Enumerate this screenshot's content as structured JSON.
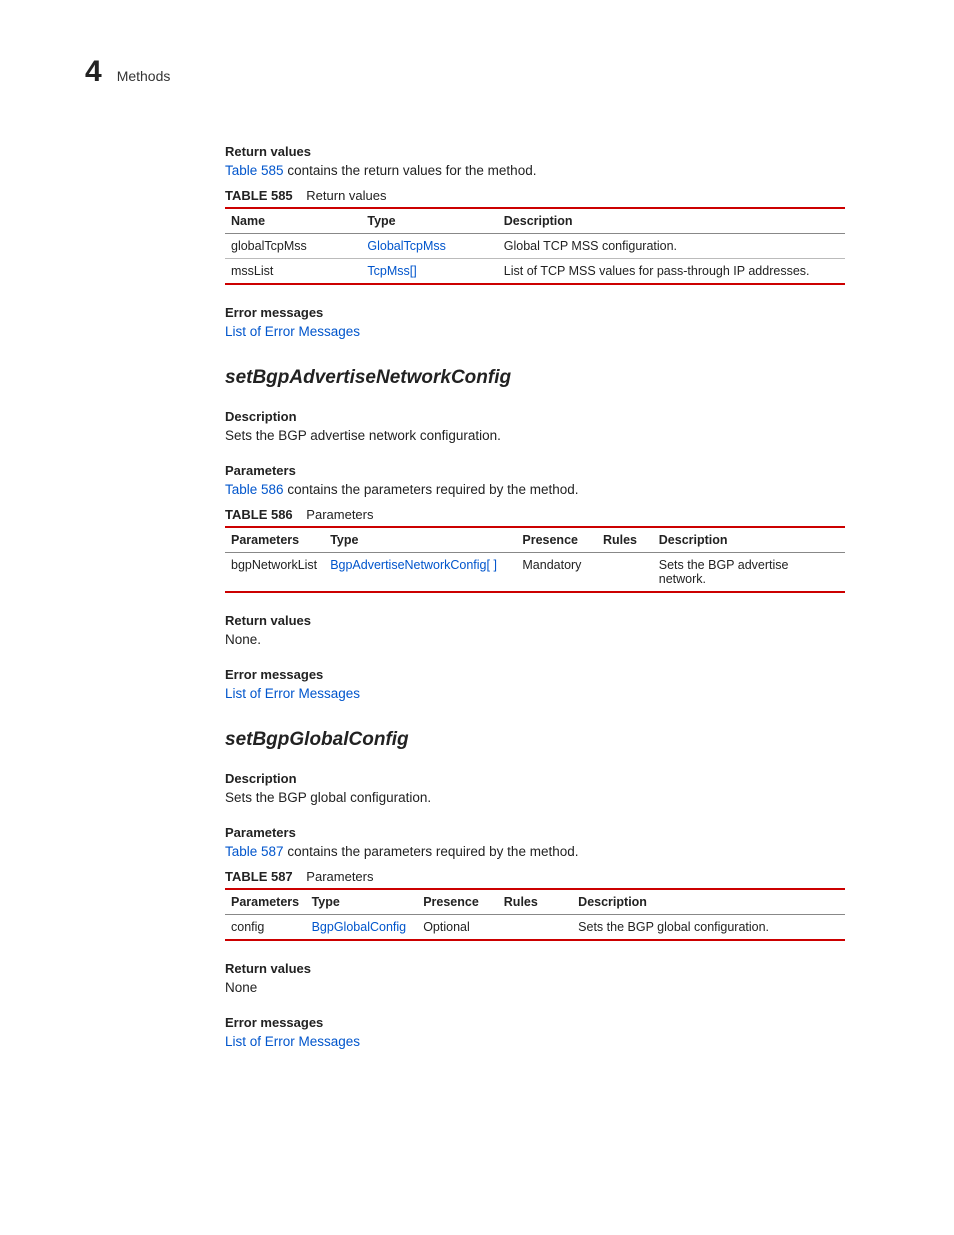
{
  "header": {
    "chapter": "4",
    "title": "Methods"
  },
  "sections": {
    "returnValues1": {
      "heading": "Return values",
      "introLink": "Table 585",
      "introRest": " contains the return values for the method.",
      "tableCaption": {
        "label": "TABLE 585",
        "title": "Return values"
      },
      "cols": [
        "Name",
        "Type",
        "Description"
      ],
      "rows": [
        {
          "name": "globalTcpMss",
          "type": "GlobalTcpMss",
          "desc": "Global TCP MSS configuration."
        },
        {
          "name": "mssList",
          "type": "TcpMss[]",
          "desc": "List of TCP MSS values for pass-through IP addresses."
        }
      ]
    },
    "errorMsgs": {
      "heading": "Error messages",
      "link": "List of Error Messages"
    },
    "method1": {
      "title": "setBgpAdvertiseNetworkConfig",
      "descriptionH": "Description",
      "descriptionT": "Sets the BGP advertise network configuration.",
      "paramsH": "Parameters",
      "paramsIntroLink": "Table 586",
      "paramsIntroRest": " contains the parameters required by the method.",
      "tableCaption": {
        "label": "TABLE 586",
        "title": "Parameters"
      },
      "cols": [
        "Parameters",
        "Type",
        "Presence",
        "Rules",
        "Description"
      ],
      "rows": [
        {
          "p": "bgpNetworkList",
          "t": "BgpAdvertiseNetworkConfig[ ]",
          "pr": "Mandatory",
          "r": "",
          "d": "Sets the BGP advertise network."
        }
      ],
      "retH": "Return values",
      "retT": "None."
    },
    "method2": {
      "title": "setBgpGlobalConfig",
      "descriptionH": "Description",
      "descriptionT": "Sets the BGP global configuration.",
      "paramsH": "Parameters",
      "paramsIntroLink": "Table 587",
      "paramsIntroRest": " contains the parameters required by the method.",
      "tableCaption": {
        "label": "TABLE 587",
        "title": "Parameters"
      },
      "cols": [
        "Parameters",
        "Type",
        "Presence",
        "Rules",
        "Description"
      ],
      "rows": [
        {
          "p": "config",
          "t": "BgpGlobalConfig",
          "pr": "Optional",
          "r": "",
          "d": "Sets the BGP global configuration."
        }
      ],
      "retH": "Return values",
      "retT": "None"
    }
  }
}
